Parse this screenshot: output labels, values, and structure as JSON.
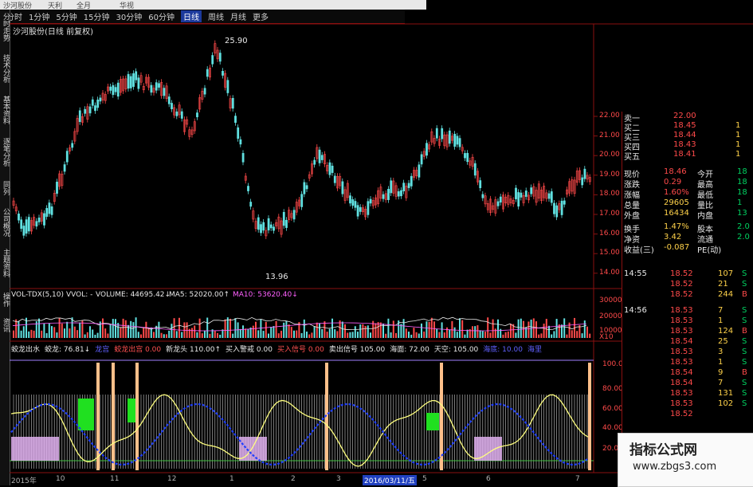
{
  "toolbar": {
    "items": [
      "分时",
      "1分钟",
      "5分钟",
      "15分钟",
      "30分钟",
      "60分钟",
      "日线",
      "周线",
      "月线",
      "更多"
    ],
    "active": "日线"
  },
  "top_strip": [
    "沙河股份",
    "天利",
    "全月",
    "华视"
  ],
  "left_tabs": [
    "分时走势",
    "技术分析",
    "基本资料",
    "逐笔分析",
    "同列",
    "公司概况",
    "主题资料",
    "操作",
    "资讯"
  ],
  "stock_title": "沙河股份(日线 前复权)",
  "price_axis": [
    "22.00",
    "21.00",
    "20.00",
    "19.00",
    "18.00",
    "17.00",
    "16.00",
    "15.00",
    "14.00"
  ],
  "price_annotations": {
    "high": "25.90",
    "low": "13.96"
  },
  "volume_header": {
    "indicator": "VOL-TDX(5,10)",
    "vvol": "VVOL: -",
    "volume": "VOLUME: 44695.42↓",
    "ma5": "MA5: 52020.00↑",
    "ma10": "MA10: 53620.40↓"
  },
  "volume_axis": [
    "30000",
    "20000",
    "10000",
    "X10"
  ],
  "indicator_header": [
    {
      "text": "蛟龙出水",
      "color": "#e8e8e8"
    },
    {
      "text": "蛟龙: 76.81↓",
      "color": "#e8e8e8"
    },
    {
      "text": "龙宫",
      "color": "#6060ff"
    },
    {
      "text": "蛟龙出宫 0.00",
      "color": "#ff5050"
    },
    {
      "text": "新龙头 110.00↑",
      "color": "#e8e8e8"
    },
    {
      "text": "买入警戒 0.00",
      "color": "#e8e8e8"
    },
    {
      "text": "买入信号 0.00",
      "color": "#ff5050"
    },
    {
      "text": "卖出信号 105.00",
      "color": "#e8e8e8"
    },
    {
      "text": "海面: 72.00",
      "color": "#e8e8e8"
    },
    {
      "text": "天空: 105.00",
      "color": "#e8e8e8"
    },
    {
      "text": "海底: 10.00",
      "color": "#6060ff"
    },
    {
      "text": "海里",
      "color": "#6060ff"
    }
  ],
  "indicator_axis": [
    "100.0",
    "80.00",
    "60.00",
    "40.00",
    "20.00"
  ],
  "date_axis": [
    "2015年",
    "10",
    "11",
    "12",
    "1",
    "2",
    "3",
    "2016/03/11/五",
    "5",
    "6",
    "7"
  ],
  "quotes": {
    "asks": [
      {
        "label": "卖一",
        "price": "22.00"
      },
      {
        "label": "买二",
        "price": "18.45",
        "vol": "1"
      },
      {
        "label": "买三",
        "price": "18.44",
        "vol": "1"
      },
      {
        "label": "买四",
        "price": "18.43",
        "vol": "1"
      },
      {
        "label": "买五",
        "price": "18.41",
        "vol": "1"
      }
    ],
    "stats": [
      {
        "l1": "现价",
        "v1": "18.46",
        "l2": "今开",
        "v2": "18"
      },
      {
        "l1": "涨跌",
        "v1": "0.29",
        "l2": "最高",
        "v2": "18"
      },
      {
        "l1": "涨幅",
        "v1": "1.60%",
        "l2": "最低",
        "v2": "18"
      },
      {
        "l1": "总量",
        "v1": "29605",
        "l2": "量比",
        "v2": "1"
      },
      {
        "l1": "外盘",
        "v1": "16434",
        "l2": "内盘",
        "v2": "13"
      },
      {
        "l1": "换手",
        "v1": "1.47%",
        "l2": "股本",
        "v2": "2.0"
      },
      {
        "l1": "净资",
        "v1": "3.42",
        "l2": "流通",
        "v2": "2.0"
      },
      {
        "l1": "收益(三)",
        "v1": "-0.087",
        "l2": "PE(动)",
        "v2": ""
      }
    ],
    "ticks": [
      {
        "time": "14:55",
        "price": "18.52",
        "vol": "107",
        "side": "S"
      },
      {
        "time": "",
        "price": "18.52",
        "vol": "21",
        "side": "S"
      },
      {
        "time": "",
        "price": "18.52",
        "vol": "244",
        "side": "B"
      },
      {
        "time": "14:56",
        "price": "18.53",
        "vol": "7",
        "side": "S"
      },
      {
        "time": "",
        "price": "18.53",
        "vol": "1",
        "side": "S"
      },
      {
        "time": "",
        "price": "18.53",
        "vol": "124",
        "side": "B"
      },
      {
        "time": "",
        "price": "18.54",
        "vol": "25",
        "side": "S"
      },
      {
        "time": "",
        "price": "18.53",
        "vol": "3",
        "side": "S"
      },
      {
        "time": "",
        "price": "18.53",
        "vol": "1",
        "side": "S"
      },
      {
        "time": "",
        "price": "18.54",
        "vol": "9",
        "side": "B"
      },
      {
        "time": "",
        "price": "18.54",
        "vol": "7",
        "side": "S"
      },
      {
        "time": "",
        "price": "18.53",
        "vol": "131",
        "side": "S"
      },
      {
        "time": "",
        "price": "18.53",
        "vol": "102",
        "side": "S"
      },
      {
        "time": "",
        "price": "18.52",
        "vol": "",
        "side": ""
      }
    ]
  },
  "watermark": {
    "title": "指标公式网",
    "url": "www.zbgs3.com"
  },
  "colors": {
    "up": "#ff4a4a",
    "down": "#60e0e0",
    "grid": "#8a1010",
    "yellow": "#ffff80",
    "blue": "#2040ff"
  }
}
